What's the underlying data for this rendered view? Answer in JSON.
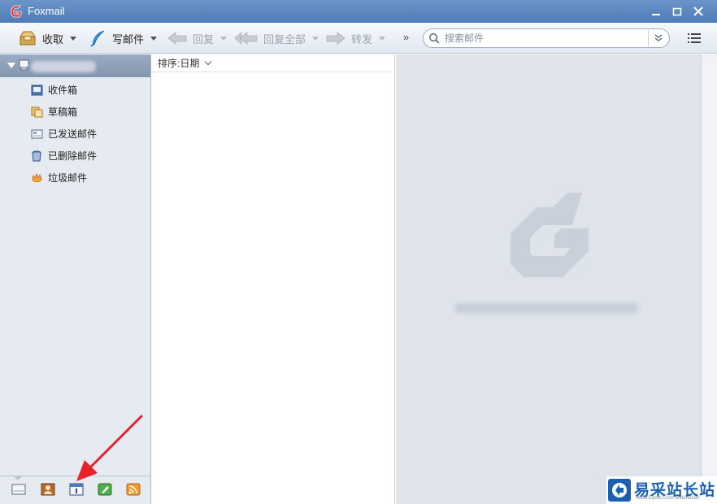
{
  "app": {
    "title": "Foxmail"
  },
  "toolbar": {
    "receive_label": "收取",
    "compose_label": "写邮件",
    "reply_label": "回复",
    "reply_all_label": "回复全部",
    "forward_label": "转发",
    "more_glyph": "»"
  },
  "search": {
    "placeholder": "搜索邮件",
    "value": ""
  },
  "sidebar": {
    "folders": [
      {
        "label": "收件箱",
        "icon": "inbox-icon"
      },
      {
        "label": "草稿箱",
        "icon": "drafts-icon"
      },
      {
        "label": "已发送邮件",
        "icon": "sent-icon"
      },
      {
        "label": "已删除邮件",
        "icon": "trash-icon"
      },
      {
        "label": "垃圾邮件",
        "icon": "spam-icon"
      }
    ],
    "bottom_tabs": [
      "mail-tab-icon",
      "contacts-tab-icon",
      "calendar-tab-icon",
      "notes-tab-icon",
      "rss-tab-icon"
    ]
  },
  "list": {
    "sort_label": "排序:日期"
  },
  "watermark": {
    "name": "易采站长站",
    "sub": "Www.Easck.Com  Webmaster"
  },
  "colors": {
    "titlebar": "#5a86bf",
    "accent": "#1b5fb1",
    "annotation_arrow": "#e8222a"
  }
}
